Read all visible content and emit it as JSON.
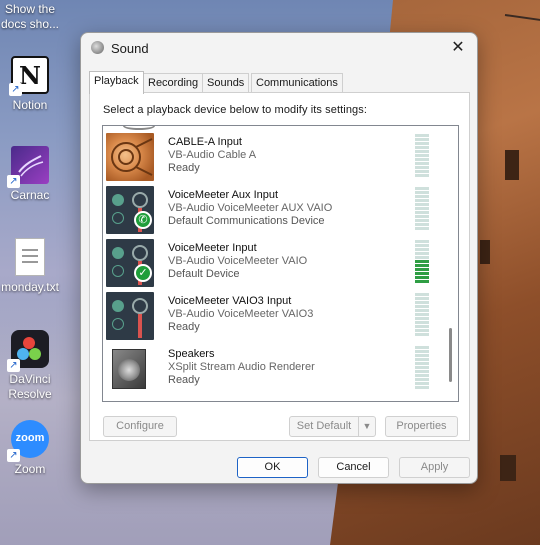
{
  "desktop": {
    "icons": [
      {
        "label": "Show the docs sho..."
      },
      {
        "label": "Notion",
        "glyph": "N"
      },
      {
        "label": "Carnac"
      },
      {
        "label": "monday.txt"
      },
      {
        "label": "DaVinci Resolve"
      },
      {
        "label": "Zoom",
        "glyph": "zoom"
      }
    ]
  },
  "dialog": {
    "title": "Sound",
    "close_glyph": "✕",
    "tabs": [
      {
        "label": "Playback",
        "active": true
      },
      {
        "label": "Recording"
      },
      {
        "label": "Sounds"
      },
      {
        "label": "Communications"
      }
    ],
    "instruction": "Select a playback device below to modify its settings:",
    "devices": [
      {
        "name": "CABLE-A Input",
        "driver": "VB-Audio Cable A",
        "status": "Ready",
        "icon": "cable-icon",
        "level": 0
      },
      {
        "name": "VoiceMeeter Aux Input",
        "driver": "VB-Audio VoiceMeeter AUX VAIO",
        "status": "Default Communications Device",
        "icon": "voicemeeter-icon",
        "badge": "phone-icon",
        "level": 0
      },
      {
        "name": "VoiceMeeter Input",
        "driver": "VB-Audio VoiceMeeter VAIO",
        "status": "Default Device",
        "icon": "voicemeeter-icon",
        "badge": "check-icon",
        "level": 0.5
      },
      {
        "name": "VoiceMeeter VAIO3 Input",
        "driver": "VB-Audio VoiceMeeter VAIO3",
        "status": "Ready",
        "icon": "voicemeeter-icon",
        "level": 0
      },
      {
        "name": "Speakers",
        "driver": "XSplit  Stream  Audio  Renderer",
        "status": "Ready",
        "icon": "speaker-icon",
        "level": 0
      }
    ],
    "buttons": {
      "configure": "Configure",
      "set_default": "Set Default",
      "properties": "Properties",
      "ok": "OK",
      "cancel": "Cancel",
      "apply": "Apply"
    }
  },
  "colors": {
    "accent": "#1e63c6",
    "level_on": "#2f9e44",
    "level_off": "#cfe0dc"
  }
}
